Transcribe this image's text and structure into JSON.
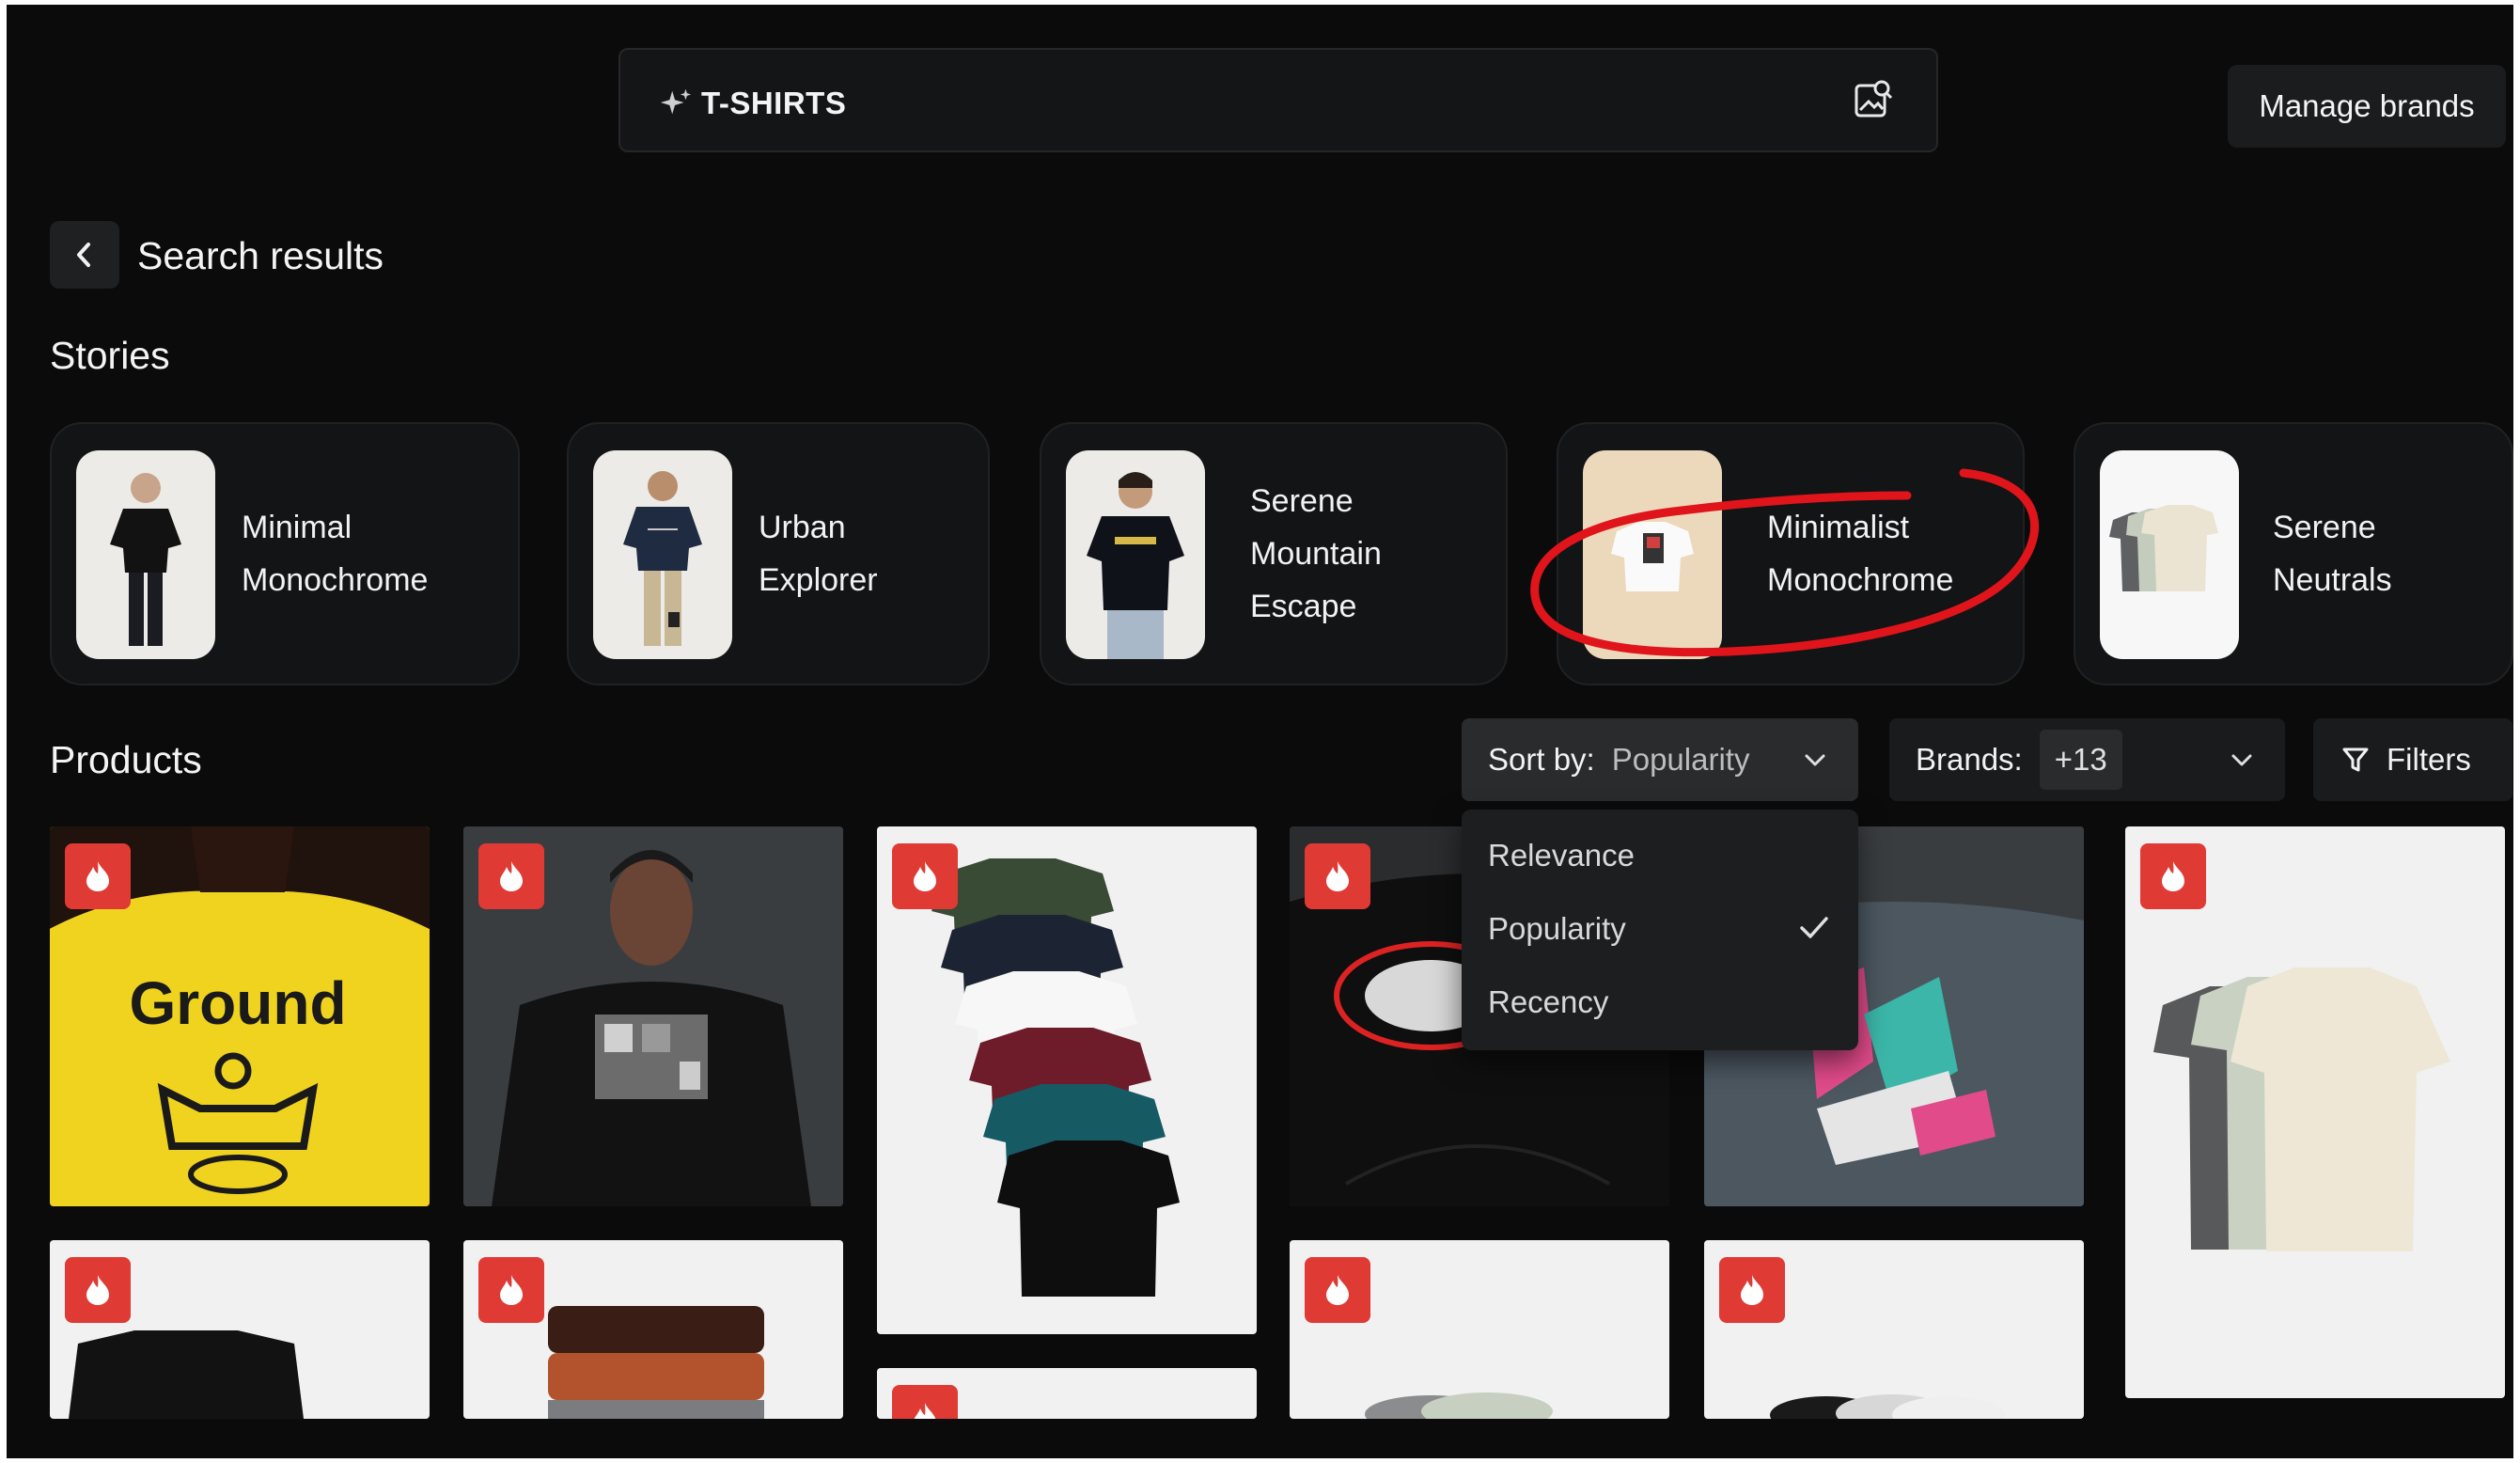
{
  "search": {
    "query": "T-SHIRTS",
    "ai_icon": "sparkle-icon",
    "image_search_icon": "image-search-icon"
  },
  "header": {
    "manage_brands": "Manage brands"
  },
  "results": {
    "back_icon": "chevron-left-icon",
    "title": "Search results"
  },
  "stories": {
    "heading": "Stories",
    "items": [
      {
        "lines": [
          "Minimal",
          "Monochrome"
        ]
      },
      {
        "lines": [
          "Urban",
          "Explorer"
        ]
      },
      {
        "lines": [
          "Serene",
          "Mountain",
          "Escape"
        ]
      },
      {
        "lines": [
          "Minimalist",
          "Monochrome"
        ],
        "highlighted": true
      },
      {
        "lines": [
          "Serene",
          "Neutrals"
        ]
      }
    ]
  },
  "products": {
    "heading": "Products",
    "sort": {
      "label": "Sort by:",
      "value": "Popularity",
      "options": [
        "Relevance",
        "Popularity",
        "Recency"
      ],
      "selected": "Popularity"
    },
    "brands": {
      "label": "Brands:",
      "count": "+13"
    },
    "filters": {
      "label": "Filters",
      "icon": "filter-icon"
    },
    "badge_icon": "flame-icon",
    "colors": {
      "badge": "#e03a35",
      "accent_ring": "#e0141b"
    }
  }
}
